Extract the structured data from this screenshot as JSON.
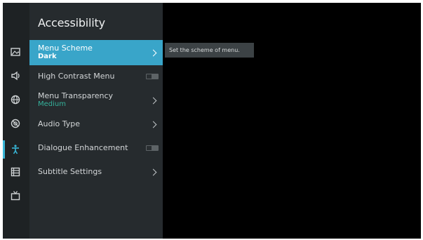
{
  "panel": {
    "title": "Accessibility"
  },
  "rail": {
    "icons": [
      "picture-icon",
      "sound-icon",
      "network-icon",
      "support-icon",
      "accessibility-icon",
      "list-icon",
      "tv-icon"
    ],
    "active": "accessibility-icon"
  },
  "items": [
    {
      "label": "Menu Scheme",
      "value": "Dark",
      "type": "submenu",
      "selected": true
    },
    {
      "label": "High Contrast Menu",
      "type": "toggle",
      "state": "off"
    },
    {
      "label": "Menu Transparency",
      "value": "Medium",
      "type": "submenu"
    },
    {
      "label": "Audio Type",
      "type": "submenu"
    },
    {
      "label": "Dialogue Enhancement",
      "type": "toggle",
      "state": "off"
    },
    {
      "label": "Subtitle Settings",
      "type": "submenu"
    }
  ],
  "tooltip": {
    "text": "Set the scheme of menu."
  },
  "colors": {
    "accent": "#39a5c9",
    "value_text": "#35b29c",
    "panel_bg": "#262b2e",
    "rail_bg": "#1e2224"
  }
}
